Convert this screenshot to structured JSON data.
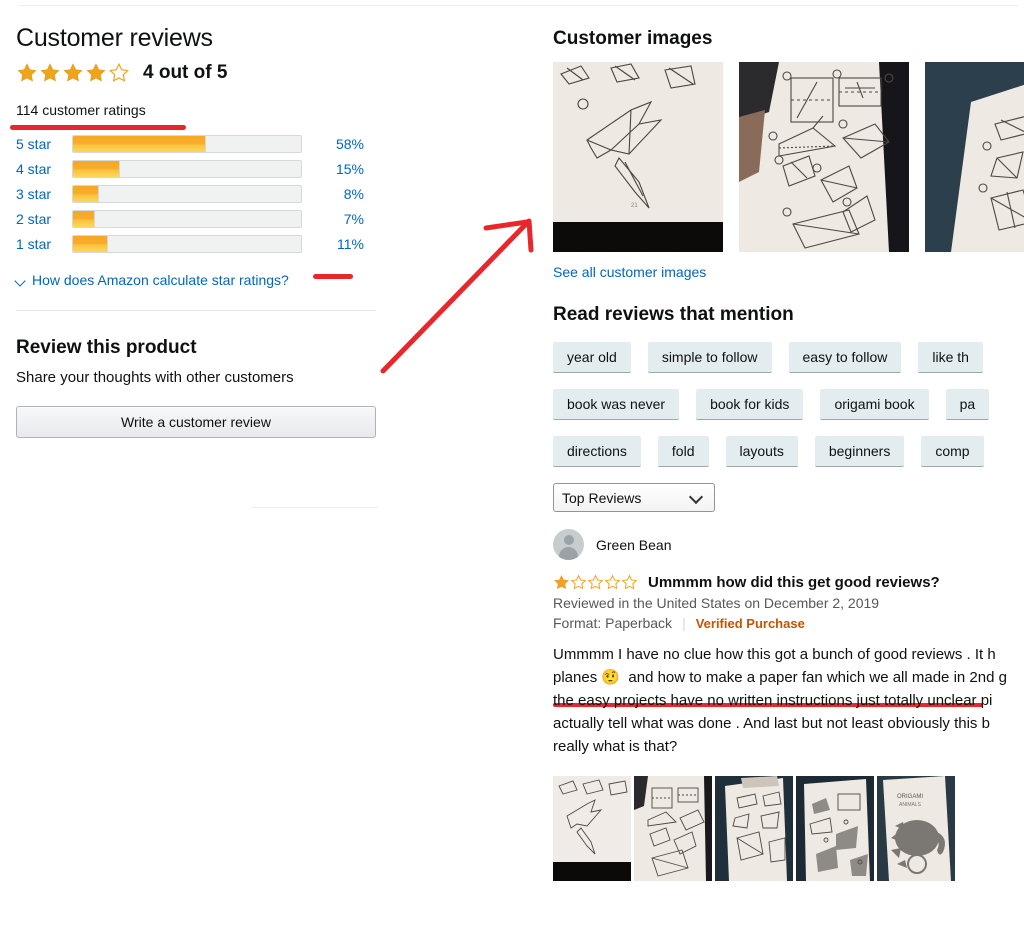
{
  "left": {
    "heading": "Customer reviews",
    "overall_rating_text": "4 out of 5",
    "overall_rating_value": 4,
    "stars_total": 5,
    "ratings_count": "114 customer ratings",
    "histogram": [
      {
        "label": "5 star",
        "percent": "58%",
        "value": 58
      },
      {
        "label": "4 star",
        "percent": "15%",
        "value": 15
      },
      {
        "label": "3 star",
        "percent": "8%",
        "value": 8
      },
      {
        "label": "2 star",
        "percent": "7%",
        "value": 7
      },
      {
        "label": "1 star",
        "percent": "11%",
        "value": 11
      }
    ],
    "how_link": "How does Amazon calculate star ratings?",
    "review_product_heading": "Review this product",
    "share_thoughts": "Share your thoughts with other customers",
    "write_review_button": "Write a customer review"
  },
  "right": {
    "customer_images_heading": "Customer images",
    "see_all_images": "See all customer images",
    "mention_heading": "Read reviews that mention",
    "tag_rows": [
      [
        "year old",
        "simple to follow",
        "easy to follow",
        "like th"
      ],
      [
        "book was never",
        "book for kids",
        "origami book",
        "pa"
      ],
      [
        "directions",
        "fold",
        "layouts",
        "beginners",
        "comp"
      ]
    ],
    "sort": {
      "selected": "Top Reviews"
    },
    "review": {
      "author": "Green Bean",
      "rating_value": 1,
      "stars_total": 5,
      "title": "Ummmm how did this get good reviews?",
      "meta": "Reviewed in the United States on December 2, 2019",
      "format": "Format: Paperback",
      "verified": "Verified Purchase",
      "body": "Ummmm I have no clue how this got a bunch of good reviews . It h\nplanes 🤨  and how to make a paper fan which we all made in 2nd g\nthe easy projects have no written instructions just totally unclear pi\nactually tell what was done . And last but not least obviously this b\nreally what is that?"
    }
  },
  "colors": {
    "link": "#0066c0",
    "star": "#f0a41d",
    "annotation_red": "#e8262b",
    "verified_orange": "#c45500",
    "tag_bg": "#e3edf0"
  }
}
